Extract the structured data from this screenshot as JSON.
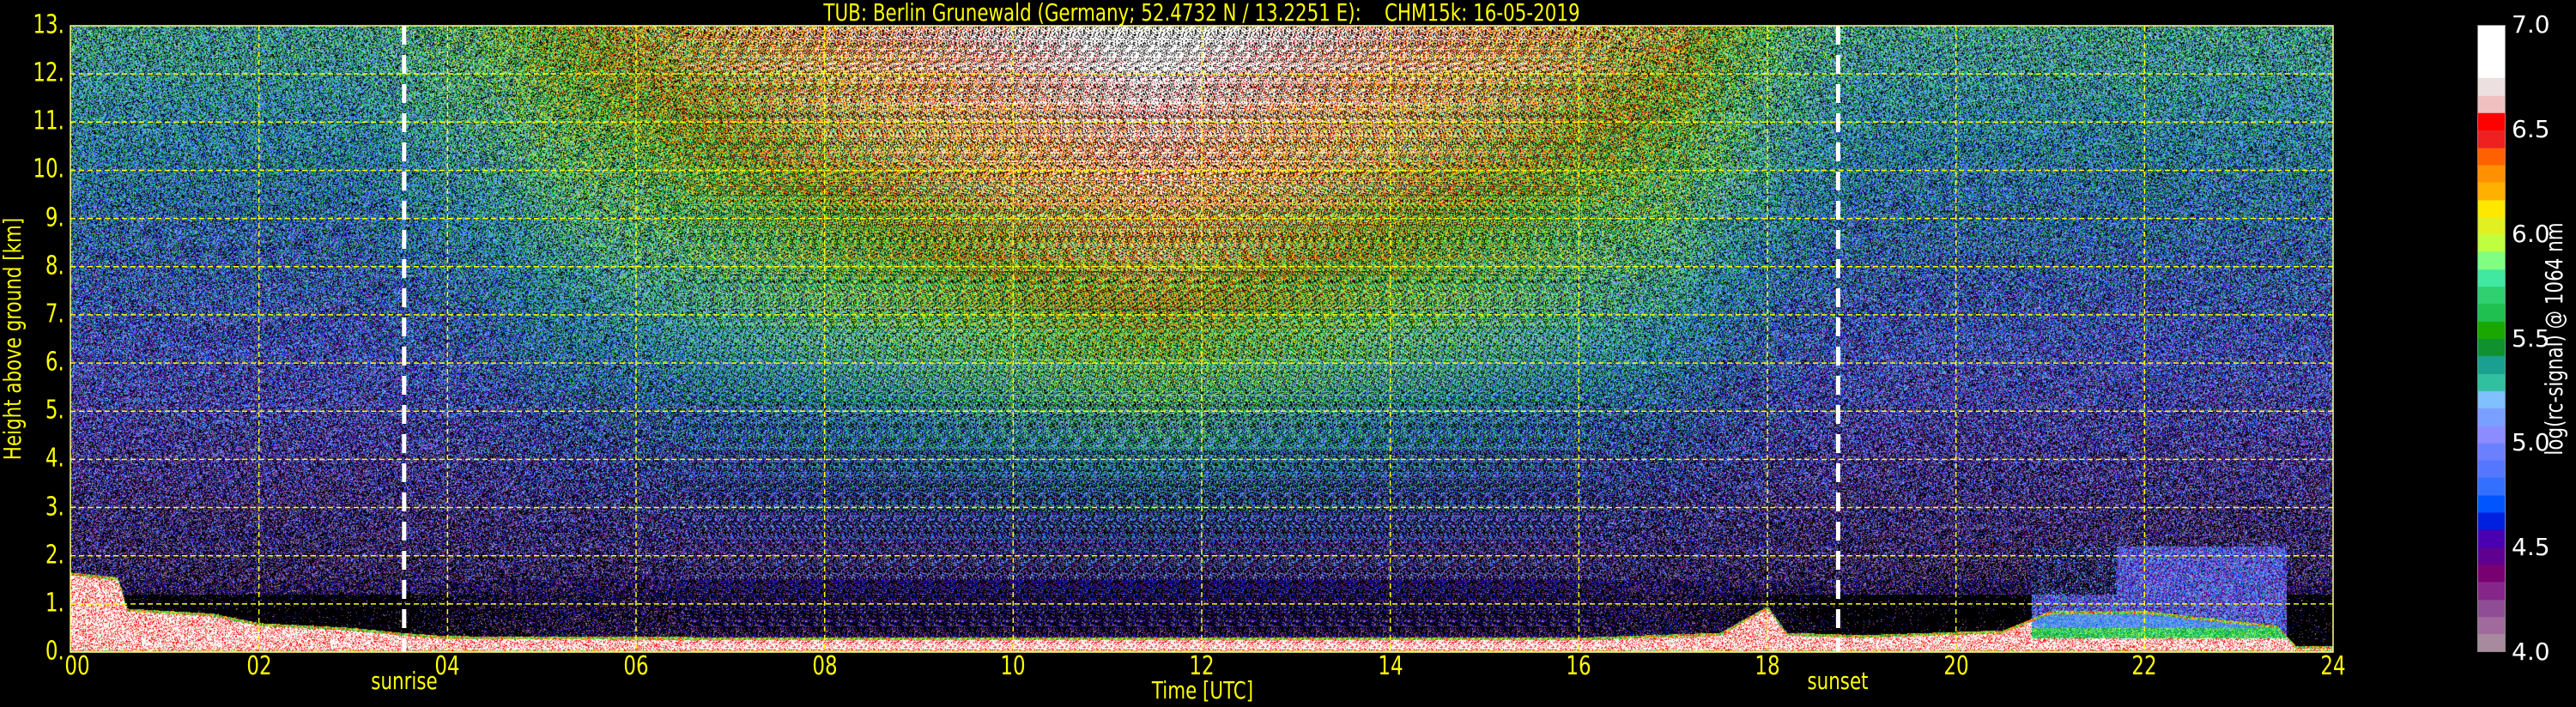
{
  "chart_data": {
    "type": "heatmap",
    "title": "TUB: Berlin Grunewald (Germany; 52.4732 N / 13.2251 E):    CHM15k: 16-05-2019",
    "xlabel": "Time [UTC]",
    "ylabel": "Height above ground [km]",
    "xlim": [
      0,
      24
    ],
    "ylim": [
      0,
      13
    ],
    "x_ticks": [
      0,
      2,
      4,
      6,
      8,
      10,
      12,
      14,
      16,
      18,
      20,
      22,
      24
    ],
    "x_tick_labels": [
      "00",
      "02",
      "04",
      "06",
      "08",
      "10",
      "12",
      "14",
      "16",
      "18",
      "20",
      "22",
      "24"
    ],
    "y_ticks": [
      0,
      1,
      2,
      3,
      4,
      5,
      6,
      7,
      8,
      9,
      10,
      11,
      12,
      13
    ],
    "y_tick_labels": [
      "0.",
      "1.",
      "2.",
      "3.",
      "4.",
      "5.",
      "6.",
      "7.",
      "8.",
      "9.",
      "10.",
      "11.",
      "12.",
      "13."
    ],
    "grid": true,
    "grid_color": "#ffff00",
    "markers": [
      {
        "label": "sunrise",
        "time_h": 3.54,
        "color": "#ffffff"
      },
      {
        "label": "sunset",
        "time_h": 18.75,
        "color": "#ffffff"
      }
    ],
    "colorbar": {
      "label": "log(rc-signal) @ 1064 nm",
      "range": [
        4.0,
        7.0
      ],
      "ticks": [
        4.0,
        4.5,
        5.0,
        5.5,
        6.0,
        6.5,
        7.0
      ],
      "tick_labels": [
        "4.0",
        "4.5",
        "5.0",
        "5.5",
        "6.0",
        "6.5",
        "7.0"
      ],
      "colors": [
        "#a88a9f",
        "#a06a9c",
        "#8e4d95",
        "#86258a",
        "#780070",
        "#5e0090",
        "#4a00b0",
        "#0020e0",
        "#0055ff",
        "#3370ff",
        "#5577ff",
        "#6a80ff",
        "#8a8cff",
        "#7aa0ff",
        "#80c0ff",
        "#30c0a0",
        "#1aa090",
        "#119030",
        "#1aa800",
        "#20c050",
        "#30d070",
        "#40e8a0",
        "#80ff80",
        "#c0ff40",
        "#e0f020",
        "#ffe800",
        "#ffb000",
        "#ff9000",
        "#ff6000",
        "#ee2020",
        "#ff0000",
        "#f0c0c0",
        "#ece0e0",
        "#ffffff",
        "#ffffff",
        "#ffffff"
      ]
    },
    "boundary_layer_top_km": {
      "time_h": [
        0,
        0.5,
        0.6,
        1.5,
        2,
        3,
        3.5,
        4,
        8,
        12,
        16,
        17.5,
        18,
        18.2,
        19,
        20.5,
        21,
        22,
        23.4,
        23.6,
        24
      ],
      "height_km": [
        1.6,
        1.5,
        0.85,
        0.75,
        0.55,
        0.45,
        0.35,
        0.28,
        0.25,
        0.25,
        0.25,
        0.35,
        0.9,
        0.35,
        0.3,
        0.4,
        0.8,
        0.8,
        0.5,
        0.08,
        0.08
      ]
    }
  }
}
